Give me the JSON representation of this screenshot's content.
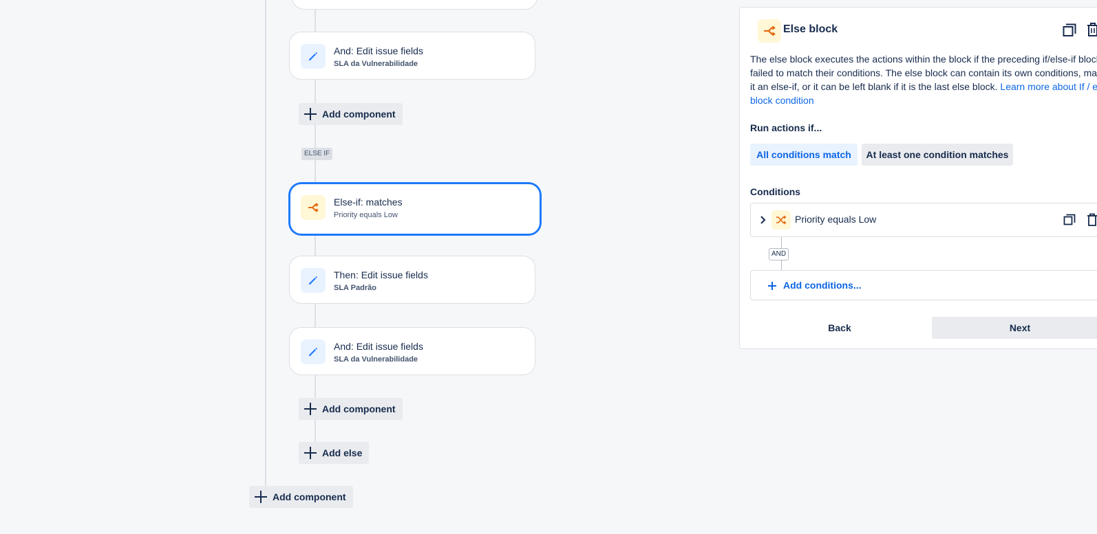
{
  "flow": {
    "cards": [
      {
        "title": "And: Edit issue fields",
        "subtitle": "SLA da Vulnerabilidade",
        "icon": "pencil-icon"
      },
      {
        "title": "Else-if: matches",
        "subtitle": "Priority equals Low",
        "icon": "branch-icon"
      },
      {
        "title": "Then: Edit issue fields",
        "subtitle": "SLA Padrão",
        "icon": "pencil-icon"
      },
      {
        "title": "And: Edit issue fields",
        "subtitle": "SLA da Vulnerabilidade",
        "icon": "pencil-icon"
      }
    ],
    "else_if_tag": "ELSE IF",
    "add_component_label": "Add component",
    "add_else_label": "Add else"
  },
  "panel": {
    "title": "Else block",
    "description": "The else block executes the actions within the block if the preceding if/else-if blocks failed to match their conditions. The else block can contain its own conditions, making it an else-if, or it can be left blank if it is the last else block.",
    "learn_more_link": "Learn more about If / else block condition",
    "run_actions_label": "Run actions if...",
    "option_all": "All conditions match",
    "option_any": "At least one condition matches",
    "conditions_label": "Conditions",
    "condition_item": "Priority equals Low",
    "and_tag": "AND",
    "add_conditions_label": "Add conditions...",
    "back_label": "Back",
    "next_label": "Next"
  },
  "colors": {
    "accent": "#0c66e4",
    "selected_border": "#1d7afc",
    "branch_orange": "#e56910",
    "pencil_blue": "#1d7afc"
  }
}
